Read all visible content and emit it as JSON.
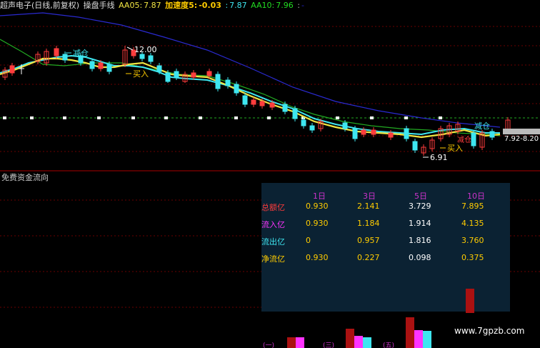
{
  "header": {
    "title": "超声电子(日线,前复权)",
    "formula": "操盘手线",
    "aa05_label": "AA05:",
    "aa05_value": "7.87",
    "accel_label": "加速度5:",
    "accel_value": "-0.03",
    "aa05b_label": ":",
    "aa05b_value": "7.87",
    "aa10_label": "AA10:",
    "aa10_value": "7.96",
    "tail": ":",
    "tail_marker": "-"
  },
  "annotations": {
    "reduce1": "减仓",
    "reduce2": "减仓",
    "reduce3": "减仓",
    "buy1": "买入",
    "buy2": "买入",
    "high_price": "12.00",
    "low_price": "6.91",
    "last_price": "7.92-8.20"
  },
  "lower_panel": {
    "title": "免费资金流向",
    "columns": [
      "1日",
      "3日",
      "5日",
      "10日"
    ],
    "rows": [
      {
        "label": "总额亿",
        "values": [
          "0.930",
          "2.141",
          "3.729",
          "7.895"
        ]
      },
      {
        "label": "流入亿",
        "values": [
          "0.930",
          "1.184",
          "1.914",
          "4.135"
        ]
      },
      {
        "label": "流出亿",
        "values": [
          "0",
          "0.957",
          "1.816",
          "3.760"
        ]
      },
      {
        "label": "净流亿",
        "values": [
          "0.930",
          "0.227",
          "0.098",
          "0.375"
        ]
      }
    ],
    "bottom_tabs": [
      "(一)",
      "(三)",
      "(五)"
    ]
  },
  "watermark": "www.7gpzb.com",
  "colors": {
    "up": "#ff3d3d",
    "down": "#3ee6f0",
    "ma5": "#f0e442",
    "ma10": "#3ee6f0",
    "ma20": "#22aa22",
    "ma60": "#2222cc",
    "label_red": "#ff3b3b",
    "label_magenta": "#ff33ff",
    "label_yellow": "#ffcc00"
  }
}
